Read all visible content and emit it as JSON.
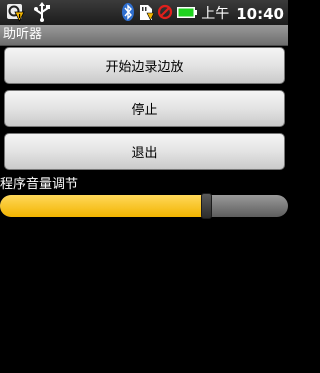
{
  "status_bar": {
    "icons_left": [
      "notification-warning-icon",
      "usb-icon"
    ],
    "icons_right": [
      "bluetooth-icon",
      "sd-card-icon",
      "no-sim-icon",
      "battery-icon"
    ],
    "ampm": "上午",
    "time": "10:40"
  },
  "app": {
    "title": "助听器"
  },
  "buttons": {
    "start": "开始边录边放",
    "stop": "停止",
    "exit": "退出"
  },
  "volume": {
    "label": "程序音量调节",
    "level": 0.72
  },
  "colors": {
    "accent": "#f5c300",
    "background": "#000000"
  }
}
